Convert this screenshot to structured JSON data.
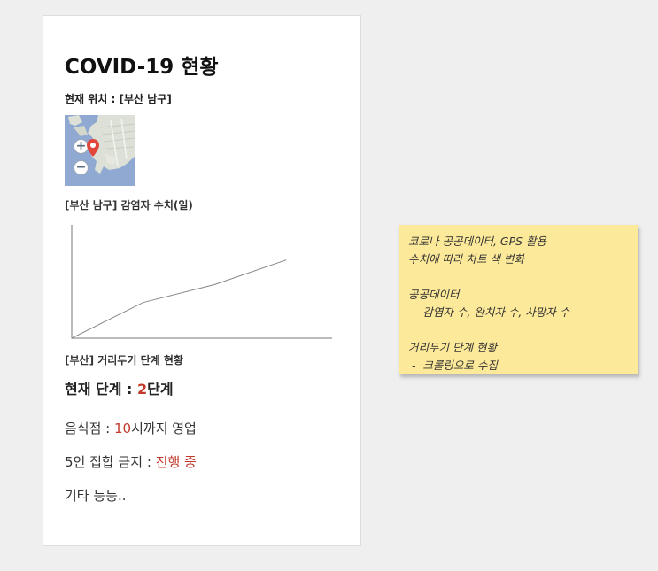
{
  "card": {
    "title": "COVID-19 현황",
    "location_label": "현재 위치 : [부산 남구]",
    "map": {
      "zoom_in": "+",
      "zoom_out": "−",
      "colors": {
        "water": "#8fa9d3",
        "land": "#dde0d6",
        "road": "#f3f3ef",
        "pin": "#e0463a"
      }
    },
    "chart_label": "[부산 남구] 감염자 수치(일)",
    "stage_label": "[부산] 거리두기 단계 현황",
    "current_stage": {
      "prefix": "현재 단계 : ",
      "value": "2",
      "suffix": "단계"
    },
    "rules": [
      {
        "prefix": "음식점 : ",
        "value": "10",
        "suffix": "시까지 영업"
      },
      {
        "prefix": "5인 집합 금지 : ",
        "value": "진행 중",
        "suffix": ""
      }
    ],
    "etc": "기타 등등.."
  },
  "chart_data": {
    "type": "line",
    "title": "",
    "xlabel": "",
    "ylabel": "",
    "x": [
      0,
      1,
      2,
      3
    ],
    "series": [
      {
        "values": [
          0,
          32,
          48,
          70
        ]
      }
    ],
    "xlim": [
      0,
      3.6
    ],
    "ylim": [
      0,
      100
    ],
    "grid": false,
    "line_color": "#888888"
  },
  "sticky_note": {
    "lines": [
      "코로나 공공데이터, GPS 활용",
      "수치에 따라 차트 색 변화",
      "",
      "공공데이터",
      " -  감염자 수, 완치자 수, 사망자 수",
      "",
      "거리두기 단계 현황",
      " -  크롤링으로 수집"
    ],
    "background": "#fde99a"
  }
}
